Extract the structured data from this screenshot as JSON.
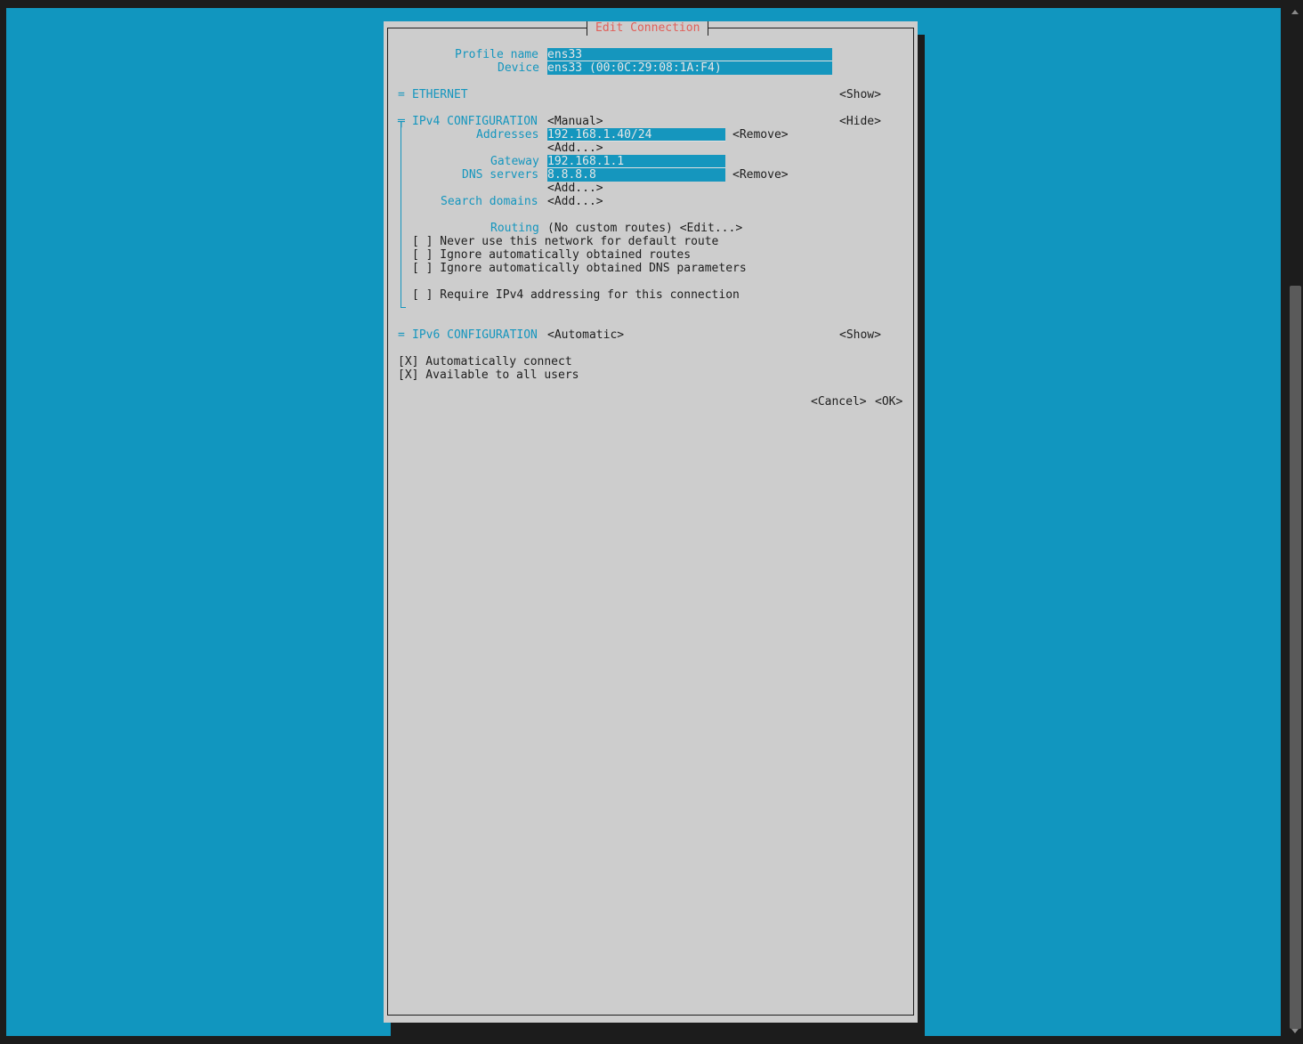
{
  "dialog": {
    "title": "Edit Connection",
    "profile_name_label": "Profile name",
    "profile_name_value": "ens33",
    "device_label": "Device",
    "device_value": "ens33 (00:0C:29:08:1A:F4)",
    "ethernet": {
      "marker": "=",
      "label": "ETHERNET",
      "toggle": "<Show>"
    },
    "ipv4": {
      "marker": "╤",
      "label": "IPv4 CONFIGURATION",
      "mode": "<Manual>",
      "toggle": "<Hide>",
      "addresses_label": "Addresses",
      "address_value": "192.168.1.40/24",
      "remove_address": "<Remove>",
      "add_address": "<Add...>",
      "gateway_label": "Gateway",
      "gateway_value": "192.168.1.1",
      "dns_label": "DNS servers",
      "dns_value": "8.8.8.8",
      "remove_dns": "<Remove>",
      "add_dns": "<Add...>",
      "search_domains_label": "Search domains",
      "add_search_domain": "<Add...>",
      "routing_label": "Routing",
      "routing_value": "(No custom routes) <Edit...>",
      "never_default": "[ ] Never use this network for default route",
      "ignore_routes": "[ ] Ignore automatically obtained routes",
      "ignore_dns": "[ ] Ignore automatically obtained DNS parameters",
      "require_ipv4": "[ ] Require IPv4 addressing for this connection"
    },
    "ipv6": {
      "marker": "=",
      "label": "IPv6 CONFIGURATION",
      "mode": "<Automatic>",
      "toggle": "<Show>"
    },
    "auto_connect": "[X] Automatically connect",
    "all_users": "[X] Available to all users",
    "cancel": "<Cancel>",
    "ok": "<OK>"
  },
  "colors": {
    "background": "#1196bf",
    "dialog": "#cdcdcd",
    "label": "#1596be",
    "title": "#e0605a",
    "text": "#1e1e1e"
  }
}
